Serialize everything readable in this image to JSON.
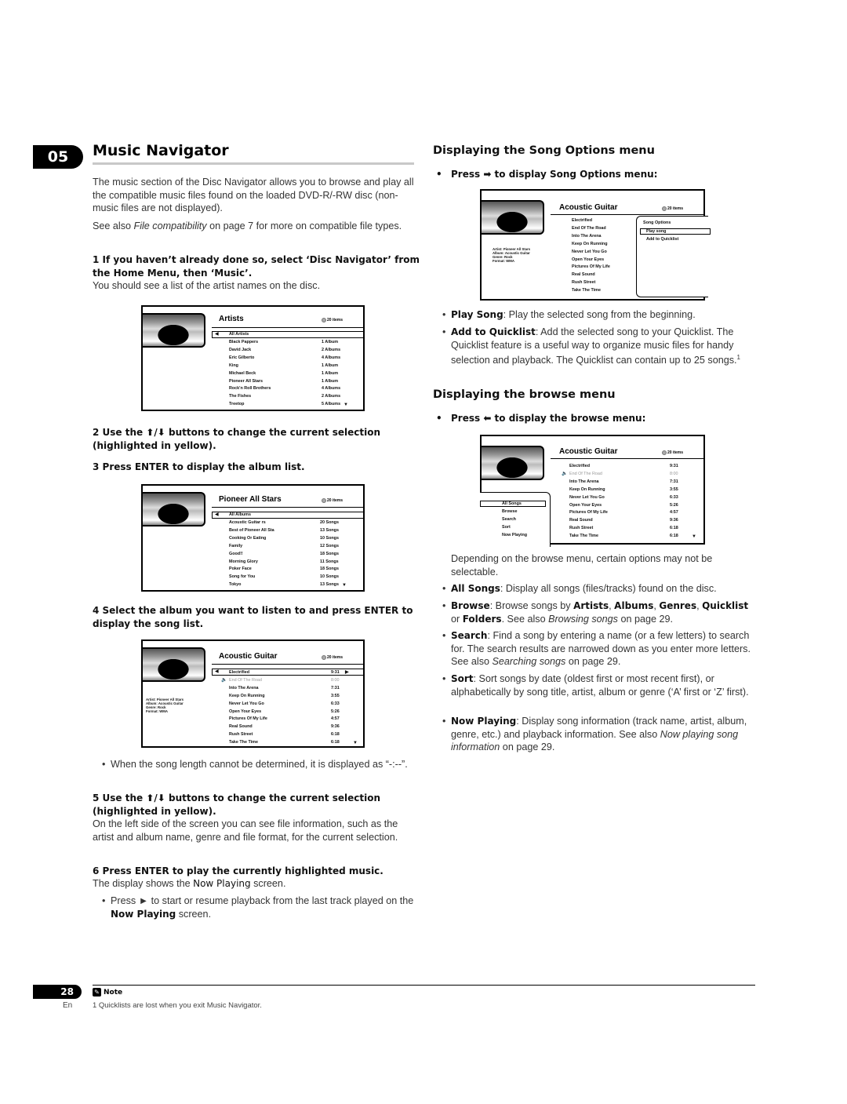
{
  "chapter": {
    "number": "05",
    "title": "Music Navigator"
  },
  "left": {
    "intro_p1": "The music section of the Disc Navigator allows you to browse and play all the compatible music files found on the loaded DVD-R/-RW disc (non-music files are not displayed).",
    "intro_p2_pre": "See also ",
    "intro_p2_link": "File compatibility",
    "intro_p2_post": " on page 7 for more on compatible file types.",
    "step1": "1   If you haven’t already done so, select ‘Disc Navigator’ from the Home Menu, then ‘Music’.",
    "step1_sub": "You should see a list of the artist names on the disc.",
    "step2": "2   Use the ⬆/⬇ buttons to change the current selection (highlighted in yellow).",
    "step3": "3   Press ENTER to display the album list.",
    "step4": "4   Select the album you want to listen to and press ENTER to display the song list.",
    "bullet_song_length": "When the song length cannot be determined, it is displayed as “-:--”.",
    "step5": "5   Use the ⬆/⬇ buttons to change the current selection (highlighted in yellow).",
    "step5_sub": "On the left side of the screen you can see file information, such as the artist and album name, genre and file format, for the current selection.",
    "step6": "6   Press ENTER to play the currently highlighted music.",
    "step6_sub_pre": "The display shows the ",
    "step6_sub_bold": "Now Playing",
    "step6_sub_post": " screen.",
    "bullet_press_pre": "Press ► to start or resume playback from the last track played on the ",
    "bullet_press_bold": "Now Playing",
    "bullet_press_post": " screen."
  },
  "screens": {
    "artists": {
      "title": "Artists",
      "count": "20 items",
      "header_row": "All Artists",
      "rows": [
        {
          "name": "Black Pappers",
          "value": "1  Album"
        },
        {
          "name": "David Jack",
          "value": "2  Albums"
        },
        {
          "name": "Eric Gilberto",
          "value": "4  Albums"
        },
        {
          "name": "King",
          "value": "1  Album"
        },
        {
          "name": "Michael Beck",
          "value": "1  Album"
        },
        {
          "name": "Pioneer All Stars",
          "value": "1  Album"
        },
        {
          "name": "Rock'n Roll Brothers",
          "value": "4  Albums"
        },
        {
          "name": "The Fishes",
          "value": "2  Albums"
        },
        {
          "name": "Treetop",
          "value": "5  Albums"
        }
      ]
    },
    "albums": {
      "title": "Pioneer All Stars",
      "count": "20 items",
      "header_row": "All Albums",
      "rows": [
        {
          "name": "Acoustic Guitar            rs",
          "value": "20 Songs"
        },
        {
          "name": "Best of Pioneer All Sta",
          "value": "13 Songs"
        },
        {
          "name": "Cooking Or Eating",
          "value": "10 Songs"
        },
        {
          "name": "Family",
          "value": "12 Songs"
        },
        {
          "name": "Good!!",
          "value": "18 Songs"
        },
        {
          "name": "Morning Glory",
          "value": "11 Songs"
        },
        {
          "name": "Poker Face",
          "value": "18 Songs"
        },
        {
          "name": "Song for You",
          "value": "10 Songs"
        },
        {
          "name": "Tokyo",
          "value": "13 Songs"
        }
      ]
    },
    "songs": {
      "title": "Acoustic Guitar",
      "count": "20 items",
      "info": [
        "Artist: Pioneer All Stars",
        "Album: Acoustic Guitar",
        "Genre: Rock",
        "Format: WMA"
      ],
      "rows": [
        {
          "name": "Electrified",
          "value": "9:31"
        },
        {
          "name": "End  Of  The  Road",
          "value": "8:00",
          "dim": true
        },
        {
          "name": "Into  The  Arena",
          "value": "7:31"
        },
        {
          "name": "Keep  On Running",
          "value": "3:55"
        },
        {
          "name": "Never  Let  You  Go",
          "value": "6:33"
        },
        {
          "name": "Open  Your  Eyes",
          "value": "5:26"
        },
        {
          "name": "Pictures  Of  My  Life",
          "value": "4:57"
        },
        {
          "name": "Real Sound",
          "value": "9:36"
        },
        {
          "name": "Rush  Street",
          "value": "6:18"
        },
        {
          "name": "Take  The  Time",
          "value": "6:18"
        }
      ]
    },
    "song_options": {
      "title": "Acoustic Guitar",
      "count": "20 items",
      "info": [
        "Artist: Pioneer All Stars",
        "Album: Acoustic Guitar",
        "Genre: Rock",
        "Format: WMA"
      ],
      "menu_title": "Song Options",
      "menu_items": [
        "Play song",
        "Add to Quicklist"
      ],
      "rows": [
        "Electrified",
        "End  Of  The  Road",
        "Into  The  Arena",
        "Keep  On  Running",
        "Never  Let  You  Go",
        "Open  Your  Eyes",
        "Pictures  Of  My  Life",
        "Real Sound",
        "Rush  Street",
        "Take  The  Time"
      ]
    },
    "browse": {
      "title": "Acoustic Guitar",
      "count": "20 items",
      "menu_items": [
        "All Songs",
        "Browse",
        "Search",
        "Sort",
        "Now Playing"
      ],
      "rows": [
        {
          "name": "Electrified",
          "value": "9:31"
        },
        {
          "name": "End  Of  The  Road",
          "value": "8:00",
          "dim": true
        },
        {
          "name": "Into  The  Arena",
          "value": "7:31"
        },
        {
          "name": "Keep  On Running",
          "value": "3:55"
        },
        {
          "name": "Never  Let  You  Go",
          "value": "6:33"
        },
        {
          "name": "Open  Your  Eyes",
          "value": "5:26"
        },
        {
          "name": "Pictures  Of  My  Life",
          "value": "4:57"
        },
        {
          "name": "Real Sound",
          "value": "9:36"
        },
        {
          "name": "Rush  Street",
          "value": "6:18"
        },
        {
          "name": "Take  The  Time",
          "value": "6:18"
        }
      ]
    }
  },
  "right": {
    "song_options_heading": "Displaying the Song Options menu",
    "song_options_press": "Press ➡ to display Song Options menu:",
    "b_play_song_bold": "Play Song",
    "b_play_song_text": ": Play the selected song from the beginning.",
    "b_add_quick_bold": "Add to Quicklist",
    "b_add_quick_text": ": Add the selected song to your Quicklist. The Quicklist feature is a useful way to organize music files for handy selection and playback. The Quicklist can contain up to 25 songs.",
    "b_add_quick_sup": "1",
    "browse_heading": "Displaying the browse menu",
    "browse_press": "Press ⬅ to display the browse menu:",
    "browse_note": "Depending on the browse menu, certain options may not be selectable.",
    "b_all_songs_bold": "All Songs",
    "b_all_songs_text": ": Display all songs (files/tracks) found on the disc.",
    "b_browse_bold": "Browse",
    "b_browse_text1": ": Browse songs by ",
    "b_browse_artists": "Artists",
    "b_browse_albums": "Albums",
    "b_browse_genres": "Genres",
    "b_browse_quicklist": "Quicklist",
    "b_browse_or": " or ",
    "b_browse_folders": "Folders",
    "b_browse_see": ". See also ",
    "b_browse_link": "Browsing songs",
    "b_browse_page": " on page 29.",
    "b_search_bold": "Search",
    "b_search_text": ": Find a song by entering a name (or a few letters) to search for. The search results are narrowed down as you enter more letters. See also ",
    "b_search_link": "Searching songs",
    "b_search_page": " on page 29.",
    "b_sort_bold": "Sort",
    "b_sort_text": ": Sort songs by date (oldest first or most recent first), or alphabetically by song title, artist, album or genre (‘A’ first or ‘Z’ first).",
    "b_now_bold": "Now Playing",
    "b_now_text": ": Display song information (track name, artist, album, genre, etc.) and playback information. See also ",
    "b_now_link": "Now playing song information",
    "b_now_page": " on page 29."
  },
  "footer": {
    "page_number": "28",
    "lang": "En",
    "note_label": "Note",
    "note_text": "1 Quicklists are lost when you exit Music Navigator."
  }
}
